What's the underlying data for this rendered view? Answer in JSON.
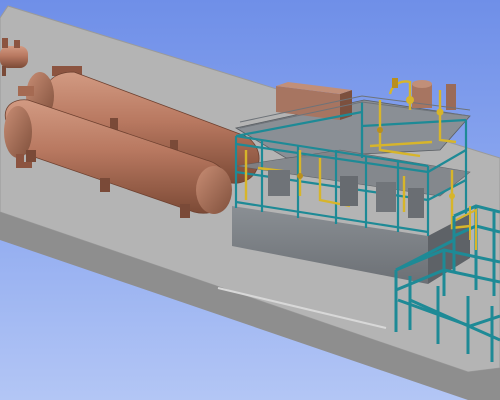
{
  "viewport": {
    "background_top": "#6f8fe8",
    "background_bottom": "#b3c6f5"
  },
  "scene": {
    "ground_slab": {
      "top_color": "#b4b4b4",
      "edge_color": "#8e8e8e"
    },
    "vessel_color": "#b87860",
    "vessel_shadow": "#8c5440",
    "steel_frame_color": "#1e8a96",
    "piping_color": "#d7b52a",
    "grating_color": "#8a8f95",
    "equipment_module_color": "#7a7f84",
    "equipment_names": [
      "horizontal-pressure-vessel-rear",
      "horizontal-pressure-vessel-front",
      "process-skid-module",
      "pipe-rack",
      "small-rear-vessel",
      "roof-equipment-tank"
    ]
  }
}
